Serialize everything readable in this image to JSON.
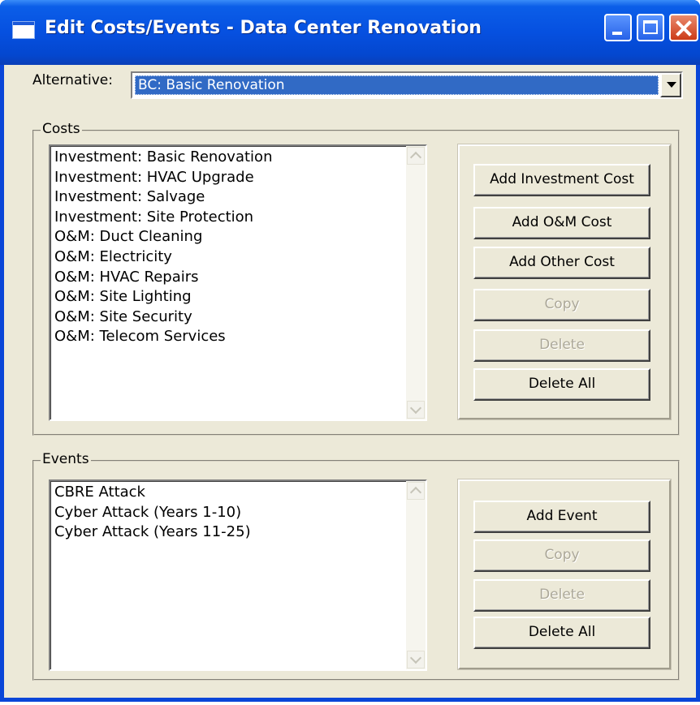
{
  "window": {
    "title": "Edit Costs/Events - Data Center Renovation"
  },
  "alternative": {
    "label": "Alternative:",
    "selected": "BC: Basic Renovation"
  },
  "costs": {
    "group_label": "Costs",
    "items": [
      "Investment: Basic Renovation",
      "Investment: HVAC Upgrade",
      "Investment: Salvage",
      "Investment: Site Protection",
      "O&M: Duct Cleaning",
      "O&M: Electricity",
      "O&M: HVAC Repairs",
      "O&M: Site Lighting",
      "O&M: Site Security",
      "O&M: Telecom Services"
    ],
    "buttons": {
      "add_investment": "Add Investment Cost",
      "add_om": "Add O&M Cost",
      "add_other": "Add Other Cost",
      "copy": "Copy",
      "delete": "Delete",
      "delete_all": "Delete All"
    }
  },
  "events": {
    "group_label": "Events",
    "items": [
      "CBRE Attack",
      "Cyber Attack (Years 1-10)",
      "Cyber Attack (Years 11-25)"
    ],
    "buttons": {
      "add_event": "Add Event",
      "copy": "Copy",
      "delete": "Delete",
      "delete_all": "Delete All"
    }
  }
}
